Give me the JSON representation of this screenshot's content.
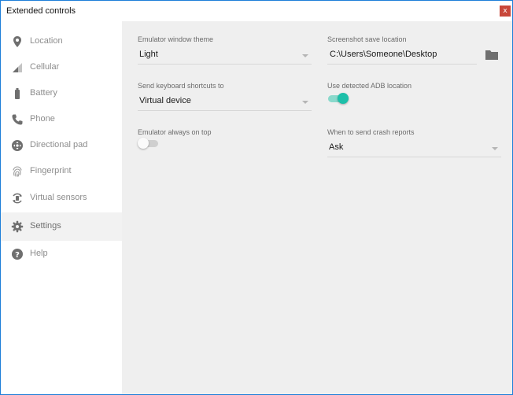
{
  "window": {
    "title": "Extended controls",
    "close_label": "x"
  },
  "sidebar": {
    "items": [
      {
        "label": "Location",
        "icon": "location-pin-icon"
      },
      {
        "label": "Cellular",
        "icon": "cellular-signal-icon"
      },
      {
        "label": "Battery",
        "icon": "battery-icon"
      },
      {
        "label": "Phone",
        "icon": "phone-icon"
      },
      {
        "label": "Directional pad",
        "icon": "dpad-icon"
      },
      {
        "label": "Fingerprint",
        "icon": "fingerprint-icon"
      },
      {
        "label": "Virtual sensors",
        "icon": "rotate-sensor-icon"
      },
      {
        "label": "Settings",
        "icon": "gear-icon",
        "active": true
      },
      {
        "label": "Help",
        "icon": "help-icon"
      }
    ]
  },
  "settings": {
    "theme": {
      "label": "Emulator window theme",
      "value": "Light"
    },
    "screenshot": {
      "label": "Screenshot save location",
      "value": "C:\\Users\\Someone\\Desktop",
      "icon": "folder-icon"
    },
    "shortcuts": {
      "label": "Send keyboard shortcuts to",
      "value": "Virtual device"
    },
    "adb": {
      "label": "Use detected ADB location",
      "on": true
    },
    "on_top": {
      "label": "Emulator always on top",
      "on": false
    },
    "crash": {
      "label": "When to send crash reports",
      "value": "Ask"
    }
  },
  "colors": {
    "accent": "#1dbfa9",
    "accent_track": "#8ad9cc",
    "icon": "#6f6f6f",
    "close": "#c8473a"
  }
}
